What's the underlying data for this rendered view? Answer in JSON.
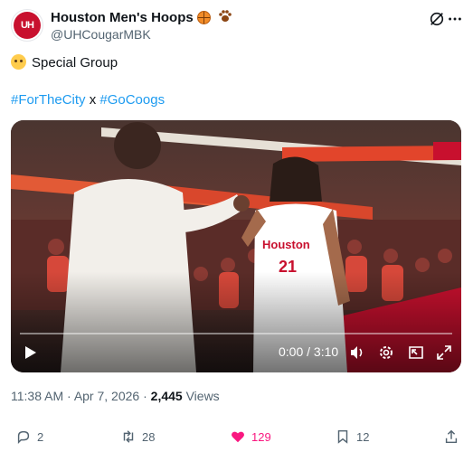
{
  "account": {
    "display_name": "Houston Men's Hoops",
    "handle": "@UHCougarMBK",
    "avatar_text": "UH"
  },
  "tweet": {
    "text": "Special Group",
    "hashtag_1": "#ForTheCity",
    "separator": " x ",
    "hashtag_2": "#GoCoogs"
  },
  "video": {
    "time": "0:00 / 3:10"
  },
  "meta": {
    "time": "11:38 AM",
    "date": "Apr 7, 2026",
    "views_count": "2,445",
    "views_label": "Views",
    "dot": "·"
  },
  "actions": {
    "replies": "2",
    "reposts": "28",
    "likes": "129",
    "bookmarks": "12"
  },
  "colors": {
    "accent": "#1d9bf0",
    "like": "#f91880",
    "brand_red": "#c8102e"
  }
}
